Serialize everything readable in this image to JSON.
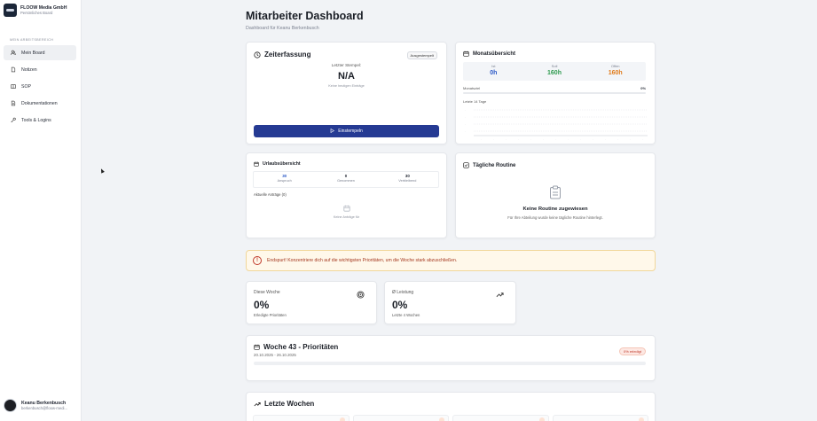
{
  "sidebar": {
    "company": "FLOOW Media GmbH",
    "board": "Persönliches Board",
    "section": "MEIN ARBEITSBEREICH",
    "items": [
      {
        "label": "Mein Board",
        "icon": "users-icon",
        "active": true
      },
      {
        "label": "Notizen",
        "icon": "note-icon",
        "active": false
      },
      {
        "label": "SOP",
        "icon": "book-icon",
        "active": false
      },
      {
        "label": "Dokumentationen",
        "icon": "document-icon",
        "active": false
      },
      {
        "label": "Tools & Logins",
        "icon": "key-icon",
        "active": false
      }
    ],
    "user": {
      "name": "Keanu Berkenbusch",
      "email": "berkenbusch@floow-medi..."
    }
  },
  "header": {
    "title": "Mitarbeiter Dashboard",
    "subtitle": "Dashboard für Keanu Berkenbusch"
  },
  "zeiterfassung": {
    "title": "Zeiterfassung",
    "status_badge": "Ausgestempelt",
    "last_label": "Letzter Stempel:",
    "last_value": "N/A",
    "note": "Keine heutigen Einträge",
    "button": "Einstempeln"
  },
  "monat": {
    "title": "Monatsübersicht",
    "stats": [
      {
        "label": "Ist",
        "value": "0h",
        "color": "#2c5ac7"
      },
      {
        "label": "Soll",
        "value": "160h",
        "color": "#2e9a4f"
      },
      {
        "label": "Offen",
        "value": "160h",
        "color": "#e07b1a"
      }
    ],
    "progress_label": "Monatsziel",
    "progress_value": "0%",
    "progress": 0,
    "chart_label": "Letzte 14 Tage"
  },
  "urlaub": {
    "title": "Urlaubsübersicht",
    "stats": [
      {
        "value": "30",
        "label": "Anspruch",
        "highlight": true
      },
      {
        "value": "0",
        "label": "Genommen",
        "highlight": false
      },
      {
        "value": "30",
        "label": "Verbleibend",
        "highlight": false
      }
    ],
    "requests_label": "Aktuelle Anträge (0)",
    "empty_text": "Keine Anträge für"
  },
  "routine": {
    "title": "Tägliche Routine",
    "empty_title": "Keine Routine zugewiesen",
    "empty_sub": "Für Ihre Abteilung wurde keine tägliche Routine hinterlegt."
  },
  "alert": {
    "text": "Endspurt! Konzentriere dich auf die wichtigsten Prioritäten, um die Woche stark abzuschließen."
  },
  "kpi": [
    {
      "label": "Diese Woche",
      "value": "0%",
      "sub": "Erledigte Prioritäten",
      "icon": "target-icon"
    },
    {
      "label": "Ø Leistung",
      "value": "0%",
      "sub": "Letzte 4 Wochen",
      "icon": "trending-up-icon"
    }
  ],
  "prioritaeten": {
    "title": "Woche 43 - Prioritäten",
    "dates": "20.10.2025 - 26.10.2025",
    "badge": "0% erledigt"
  },
  "letzte_wochen": {
    "title": "Letzte Wochen"
  }
}
